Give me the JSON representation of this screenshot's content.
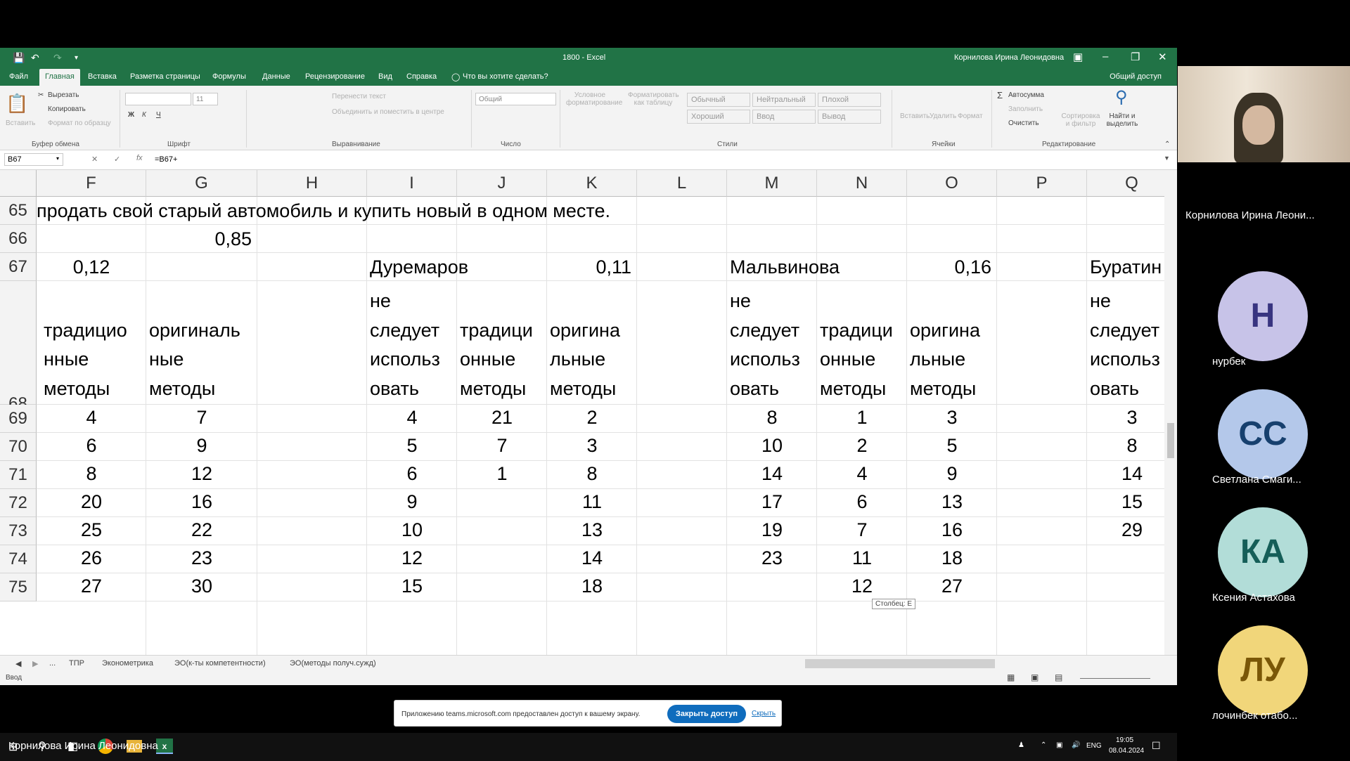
{
  "window": {
    "title": "1800  -  Excel",
    "user": "Корнилова Ирина Леонидовна"
  },
  "ribbon_tabs": [
    "Файл",
    "Главная",
    "Вставка",
    "Разметка страницы",
    "Формулы",
    "Данные",
    "Рецензирование",
    "Вид",
    "Справка"
  ],
  "tellme": "Что вы хотите сделать?",
  "share": "Общий доступ",
  "ribbon": {
    "clipboard": {
      "paste": "Вставить",
      "cut": "Вырезать",
      "copy": "Копировать",
      "format_painter": "Формат по образцу",
      "group": "Буфер обмена"
    },
    "font": {
      "size": "11",
      "group": "Шрифт",
      "bold": "Ж",
      "italic": "К",
      "underline": "Ч"
    },
    "alignment": {
      "wrap": "Перенести текст",
      "merge": "Объединить и поместить в центре",
      "group": "Выравнивание"
    },
    "number": {
      "format": "Общий",
      "group": "Число"
    },
    "styles": {
      "conditional": "Условное форматирование",
      "table": "Форматировать как таблицу",
      "normal": "Обычный",
      "neutral": "Нейтральный",
      "bad": "Плохой",
      "good": "Хороший",
      "input": "Ввод",
      "output": "Вывод",
      "group": "Стили"
    },
    "cells": {
      "insert": "Вставить",
      "delete": "Удалить",
      "format": "Формат",
      "group": "Ячейки"
    },
    "editing": {
      "autosum": "Автосумма",
      "fill": "Заполнить",
      "clear": "Очистить",
      "sort": "Сортировка и фильтр",
      "find": "Найти и выделить",
      "group": "Редактирование"
    }
  },
  "formula_bar": {
    "name_box": "B67",
    "formula": "=B67+"
  },
  "columns": [
    {
      "letter": "F"
    },
    {
      "letter": "G"
    },
    {
      "letter": "H"
    },
    {
      "letter": "I"
    },
    {
      "letter": "J"
    },
    {
      "letter": "K"
    },
    {
      "letter": "L"
    },
    {
      "letter": "M"
    },
    {
      "letter": "N"
    },
    {
      "letter": "O"
    },
    {
      "letter": "P"
    },
    {
      "letter": "Q"
    }
  ],
  "rows": [
    "65",
    "66",
    "67",
    "68",
    "69",
    "70",
    "71",
    "72",
    "73",
    "74",
    "75"
  ],
  "cells": {
    "r65_text": "продать свой старый автомобиль и купить новый в одном месте.",
    "r66_G": "0,85",
    "r67_F": "0,12",
    "r67_I": "Дуремаров",
    "r67_K": "0,11",
    "r67_M": "Мальвинова",
    "r67_O": "0,16",
    "r67_Q": "Буратин",
    "r68_F": "традицио нные методы",
    "r68_G": "оригиналь ные методы",
    "r68_I": "методы, которые не следует использ овать",
    "r68_J": "традици онные методы",
    "r68_K": "оригина льные методы",
    "r68_M": "методы, которые не следует использ овать",
    "r68_N": "традици онные методы",
    "r68_O": "оригина льные методы",
    "r68_Q": "методы которые не следует использ овать"
  },
  "table": {
    "cols": [
      "F",
      "G",
      "I",
      "J",
      "K",
      "M",
      "N",
      "O",
      "Q"
    ],
    "values": [
      [
        "4",
        "7",
        "4",
        "21",
        "2",
        "8",
        "1",
        "3",
        "3"
      ],
      [
        "6",
        "9",
        "5",
        "7",
        "3",
        "10",
        "2",
        "5",
        "8"
      ],
      [
        "8",
        "12",
        "6",
        "1",
        "8",
        "14",
        "4",
        "9",
        "14"
      ],
      [
        "20",
        "16",
        "9",
        "",
        "11",
        "17",
        "6",
        "13",
        "15"
      ],
      [
        "25",
        "22",
        "10",
        "",
        "13",
        "19",
        "7",
        "16",
        "29"
      ],
      [
        "26",
        "23",
        "12",
        "",
        "14",
        "23",
        "11",
        "18",
        ""
      ],
      [
        "27",
        "30",
        "15",
        "",
        "18",
        "",
        "12",
        "27",
        ""
      ]
    ]
  },
  "tooltip": "Столбец: E",
  "sheet_tabs": [
    "...",
    "ТПР",
    "Эконометрика",
    "ЭО(к-ты компетентности)",
    "ЭО(методы получ.сужд)"
  ],
  "status": "Ввод",
  "banner": {
    "text": "Приложению teams.microsoft.com предоставлен доступ к вашему экрану.",
    "stop": "Закрыть доступ",
    "hide": "Скрыть"
  },
  "taskbar": {
    "lang": "ENG",
    "time": "19:05",
    "date": "08.04.2024"
  },
  "presenter_label": "Корнилова Ирина Леонидовна",
  "participants": [
    {
      "name": "Корнилова Ирина Леони...",
      "initials": ""
    },
    {
      "name": "нурбек",
      "initials": "Н"
    },
    {
      "name": "Светлана Смаги...",
      "initials": "СС"
    },
    {
      "name": "Ксения Астахова",
      "initials": "КА"
    },
    {
      "name": "лочинбек отабо...",
      "initials": "ЛУ"
    }
  ]
}
